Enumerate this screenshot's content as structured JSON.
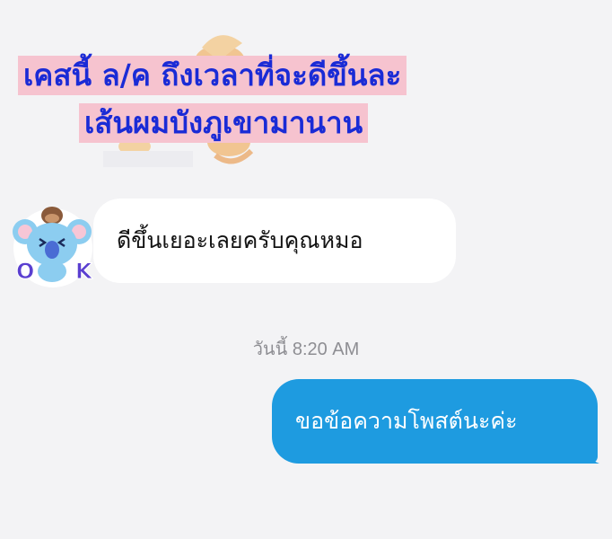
{
  "caption": {
    "line1": "เคสนี้ ล/ค ถึงเวลาที่จะดีขึ้นละ",
    "line2": "เส้นผมบังภูเขามานาน"
  },
  "chat": {
    "incoming_message": "ดีขึ้นเยอะเลยครับคุณหมอ",
    "timestamp": "วันนี้ 8:20 AM",
    "outgoing_message": "ขอข้อความโพสต์นะค่ะ"
  },
  "avatar": {
    "sticker_text": "OK",
    "icon": "koala-sticker-icon"
  },
  "colors": {
    "caption_background": "#f6c3cf",
    "caption_text": "#1a2bd6",
    "outgoing_bubble": "#1e9be0",
    "incoming_bubble": "#ffffff",
    "background": "#f3f3f5"
  }
}
